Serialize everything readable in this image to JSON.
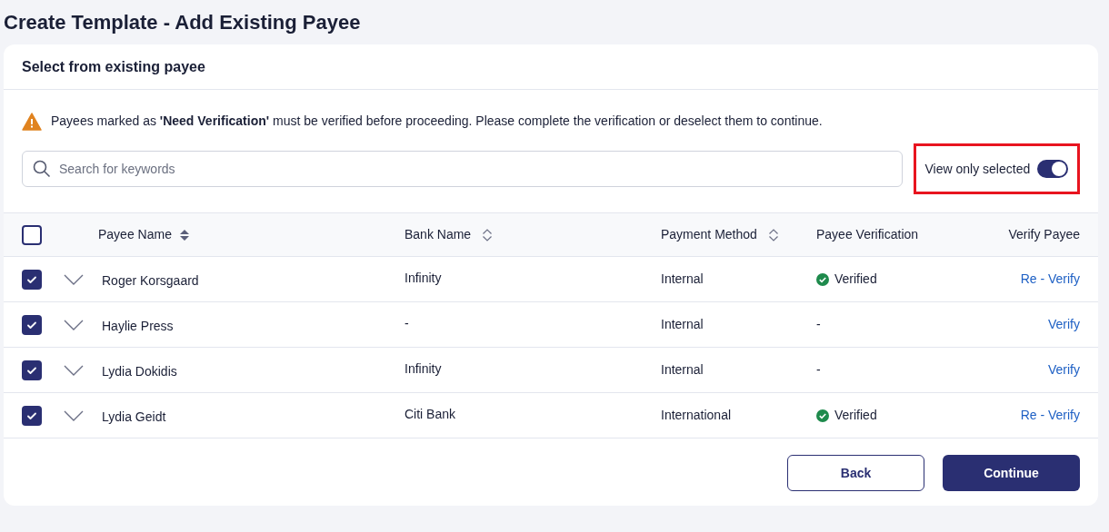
{
  "page_title": "Create Template - Add Existing Payee",
  "card_title": "Select from existing payee",
  "alert": {
    "text": "Payees marked as **'Need Verification'** must be verified before proceeding. Please complete the verification or deselect them to continue."
  },
  "search": {
    "placeholder": "Search for keywords"
  },
  "view_only_selected": {
    "label": "View only selected",
    "on": true,
    "highlighted": true
  },
  "table": {
    "select_all": {
      "checked": false
    },
    "columns": [
      {
        "label": "Payee Name",
        "kind": "sorted"
      },
      {
        "label": "Bank Name",
        "kind": "sortable"
      },
      {
        "label": "Payment Method",
        "kind": "sortable"
      },
      {
        "label": "Payee Verification",
        "kind": "plain"
      },
      {
        "label": "Verify Payee",
        "kind": "plain"
      }
    ],
    "rows": [
      {
        "checked": true,
        "expanded": false,
        "name": "Roger Korsgaard",
        "bank": "Infinity",
        "method": "Internal",
        "verification": {
          "kind": "verified",
          "text": "Verified"
        },
        "action": "Re - Verify"
      },
      {
        "checked": true,
        "expanded": false,
        "name": "Haylie Press",
        "bank": "-",
        "method": "Internal",
        "verification": {
          "kind": "none",
          "text": "-"
        },
        "action": "Verify"
      },
      {
        "checked": true,
        "expanded": false,
        "name": "Lydia Dokidis",
        "bank": "Infinity",
        "method": "Internal",
        "verification": {
          "kind": "none",
          "text": "-"
        },
        "action": "Verify"
      },
      {
        "checked": true,
        "expanded": false,
        "name": "Lydia Geidt",
        "bank": "Citi Bank",
        "method": "International",
        "verification": {
          "kind": "verified",
          "text": "Verified"
        },
        "action": "Re - Verify"
      }
    ]
  },
  "buttons": [
    {
      "kind": "secondary",
      "label": "Back"
    },
    {
      "kind": "primary",
      "label": "Continue"
    }
  ]
}
